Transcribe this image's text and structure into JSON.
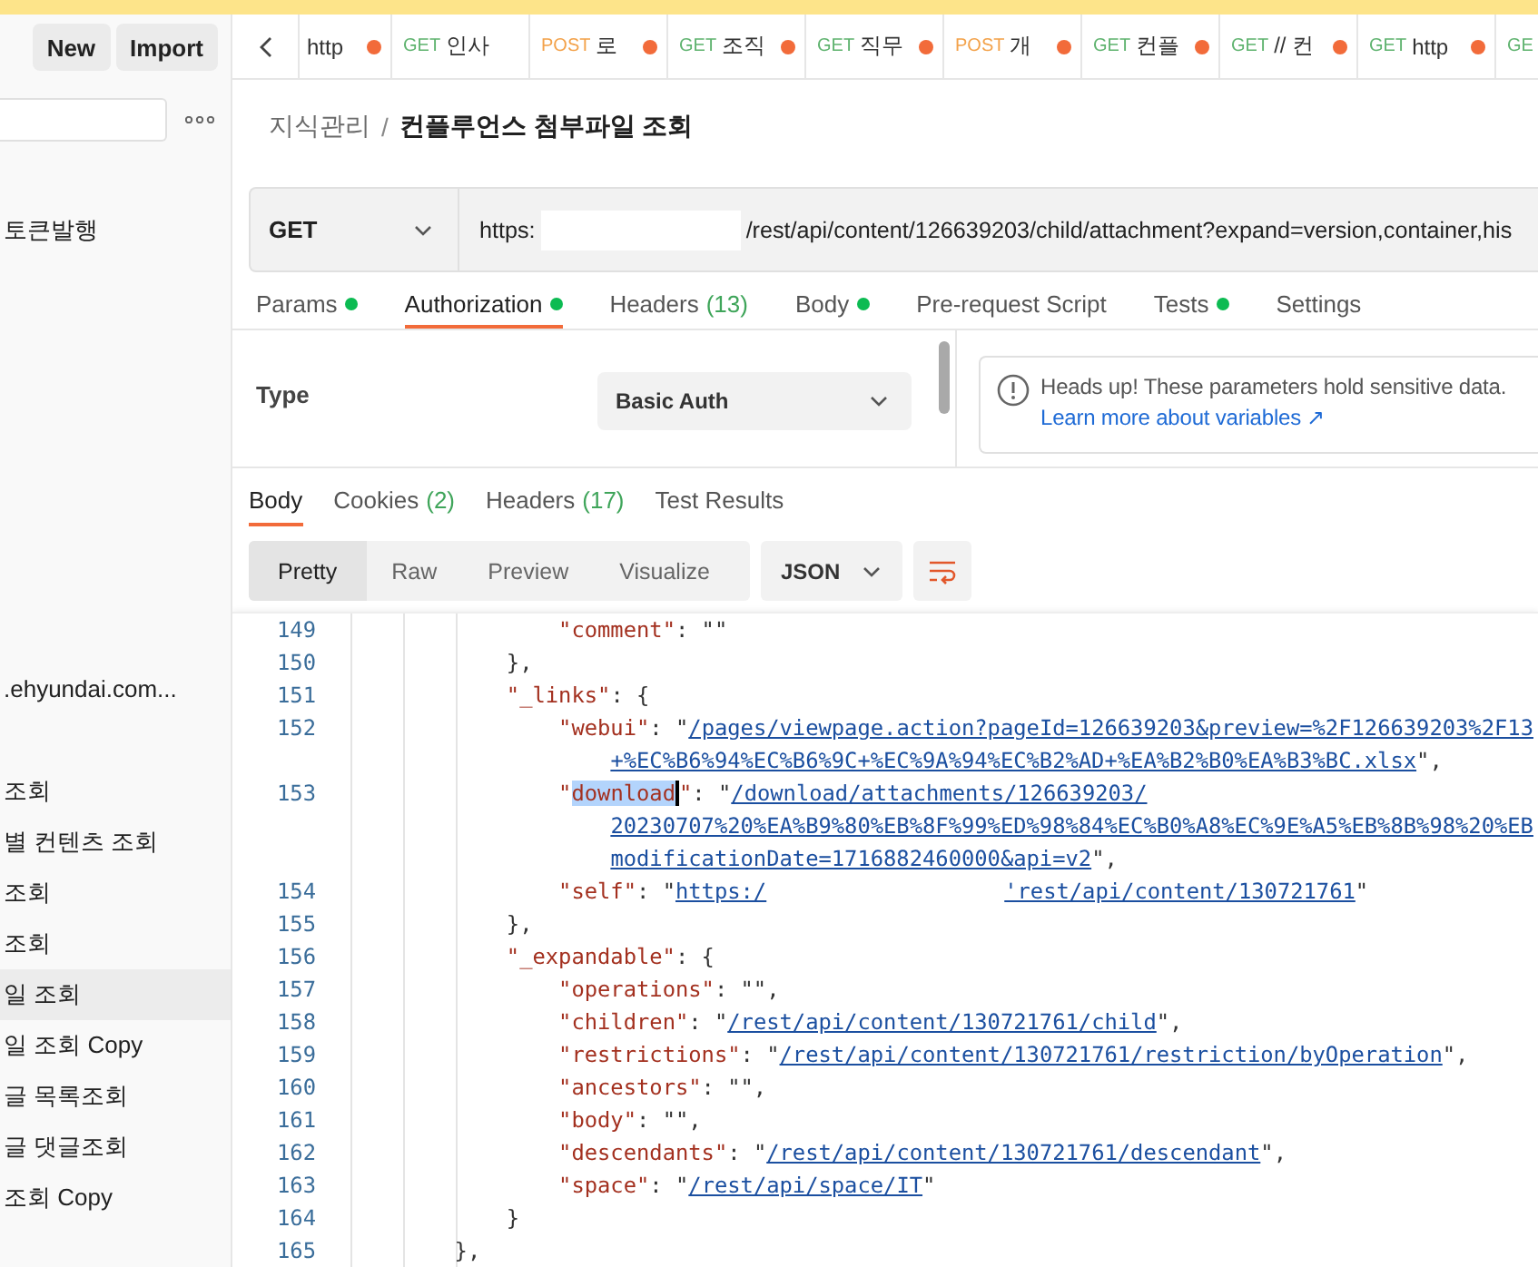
{
  "top_bar": {
    "buttons": [
      "New",
      "Import"
    ]
  },
  "sidebar": {
    "items": [
      {
        "label": "토큰발행",
        "selected": false
      },
      {
        "label": ".ehyundai.com...",
        "selected": false
      },
      {
        "label": "조회",
        "selected": false
      },
      {
        "label": "별 컨텐츠 조회",
        "selected": false
      },
      {
        "label": "조회",
        "selected": false
      },
      {
        "label": "조회",
        "selected": false
      },
      {
        "label": "일 조회",
        "selected": true
      },
      {
        "label": "일 조회 Copy",
        "selected": false
      },
      {
        "label": "글 목록조회",
        "selected": false
      },
      {
        "label": "글 댓글조회",
        "selected": false
      },
      {
        "label": "조회 Copy",
        "selected": false
      }
    ]
  },
  "open_tabs": [
    {
      "kind": "none",
      "name": "http",
      "unsaved": true
    },
    {
      "kind": "get",
      "method": "GET",
      "name": "인사",
      "unsaved": false
    },
    {
      "kind": "post",
      "method": "POST",
      "name": "로",
      "unsaved": true
    },
    {
      "kind": "get",
      "method": "GET",
      "name": "조직",
      "unsaved": true
    },
    {
      "kind": "get",
      "method": "GET",
      "name": "직무",
      "unsaved": true
    },
    {
      "kind": "post",
      "method": "POST",
      "name": "개",
      "unsaved": true
    },
    {
      "kind": "get",
      "method": "GET",
      "name": "컨플",
      "unsaved": true
    },
    {
      "kind": "get",
      "method": "GET",
      "name": "// 컨",
      "unsaved": true
    },
    {
      "kind": "get",
      "method": "GET",
      "name": "http",
      "unsaved": true
    },
    {
      "kind": "get",
      "method": "GE",
      "unsaved": false
    }
  ],
  "breadcrumb": {
    "parent": "지식관리",
    "separator": "/",
    "current": "컨플루언스 첨부파일 조회"
  },
  "request": {
    "method": "GET",
    "url_start": "https:",
    "url_end": "/rest/api/content/126639203/child/attachment?expand=version,container,his"
  },
  "request_sections": [
    {
      "label": "Params",
      "dot": true,
      "selected": false
    },
    {
      "label": "Authorization",
      "dot": true,
      "selected": true
    },
    {
      "label": "Headers",
      "count": "(13)",
      "dot": false,
      "selected": false
    },
    {
      "label": "Body",
      "dot": true,
      "selected": false
    },
    {
      "label": "Pre-request Script",
      "dot": false,
      "selected": false
    },
    {
      "label": "Tests",
      "dot": true,
      "selected": false
    },
    {
      "label": "Settings",
      "dot": false,
      "selected": false
    }
  ],
  "auth": {
    "type_label": "Type",
    "type_value": "Basic Auth",
    "notice": "Heads up! These parameters hold sensitive data.",
    "link": "Learn more about variables ↗"
  },
  "response": {
    "tabs": [
      {
        "label": "Body",
        "selected": true
      },
      {
        "label": "Cookies",
        "count": "(2)",
        "selected": false
      },
      {
        "label": "Headers",
        "count": "(17)",
        "selected": false
      },
      {
        "label": "Test Results",
        "selected": false
      }
    ],
    "views": [
      {
        "label": "Pretty",
        "selected": true
      },
      {
        "label": "Raw",
        "selected": false
      },
      {
        "label": "Preview",
        "selected": false
      },
      {
        "label": "Visualize",
        "selected": false
      }
    ],
    "format": "JSON",
    "lines": [
      {
        "number": "149",
        "rows": [
          {
            "segments": [
              {
                "kind": "key",
                "text": "                \"comment\""
              },
              {
                "kind": "punct",
                "text": ": \"\""
              }
            ]
          }
        ]
      },
      {
        "number": "150",
        "rows": [
          {
            "segments": [
              {
                "kind": "punct",
                "text": "            },"
              }
            ]
          }
        ]
      },
      {
        "number": "151",
        "rows": [
          {
            "segments": [
              {
                "kind": "key",
                "text": "            \"_links\""
              },
              {
                "kind": "punct",
                "text": ": {"
              }
            ]
          }
        ]
      },
      {
        "number": "152",
        "rows": [
          {
            "segments": [
              {
                "kind": "key",
                "text": "                \"webui\""
              },
              {
                "kind": "punct",
                "text": ": \""
              },
              {
                "kind": "link",
                "text": "/pages/viewpage.action?pageId=126639203&preview=%2F126639203%2F13"
              }
            ]
          },
          {
            "segments": [
              {
                "kind": "link",
                "text": "                    +%EC%B6%94%EC%B6%9C+%EC%9A%94%EC%B2%AD+%EA%B2%B0%EA%B3%BC.xlsx"
              },
              {
                "kind": "punct",
                "text": "\","
              }
            ]
          }
        ]
      },
      {
        "number": "153",
        "rows": [
          {
            "segments": [
              {
                "kind": "key",
                "text": "                \""
              },
              {
                "kind": "key",
                "text": "download",
                "highlighted": true
              },
              {
                "kind": "key",
                "text": "\""
              },
              {
                "kind": "punct",
                "text": ": \""
              },
              {
                "kind": "link",
                "text": "/download/attachments/126639203/"
              }
            ]
          },
          {
            "segments": [
              {
                "kind": "link",
                "text": "                    20230707%20%EA%B9%80%EB%8F%99%ED%98%84%EC%B0%A8%EC%9E%A5%EB%8B%98%20%EB"
              }
            ]
          },
          {
            "segments": [
              {
                "kind": "link",
                "text": "                    modificationDate=1716882460000&api=v2"
              },
              {
                "kind": "punct",
                "text": "\","
              }
            ]
          }
        ]
      },
      {
        "number": "154",
        "rows": [
          {
            "segments": [
              {
                "kind": "key",
                "text": "                \"self\""
              },
              {
                "kind": "punct",
                "text": ": \""
              },
              {
                "kind": "link",
                "text": "https:/"
              },
              {
                "kind": "redacted"
              },
              {
                "kind": "link",
                "text": "'rest/api/content/130721761"
              },
              {
                "kind": "punct",
                "text": "\""
              }
            ]
          }
        ]
      },
      {
        "number": "155",
        "rows": [
          {
            "segments": [
              {
                "kind": "punct",
                "text": "            },"
              }
            ]
          }
        ]
      },
      {
        "number": "156",
        "rows": [
          {
            "segments": [
              {
                "kind": "key",
                "text": "            \"_expandable\""
              },
              {
                "kind": "punct",
                "text": ": {"
              }
            ]
          }
        ]
      },
      {
        "number": "157",
        "rows": [
          {
            "segments": [
              {
                "kind": "key",
                "text": "                \"operations\""
              },
              {
                "kind": "punct",
                "text": ": \"\","
              }
            ]
          }
        ]
      },
      {
        "number": "158",
        "rows": [
          {
            "segments": [
              {
                "kind": "key",
                "text": "                \"children\""
              },
              {
                "kind": "punct",
                "text": ": \""
              },
              {
                "kind": "link",
                "text": "/rest/api/content/130721761/child"
              },
              {
                "kind": "punct",
                "text": "\","
              }
            ]
          }
        ]
      },
      {
        "number": "159",
        "rows": [
          {
            "segments": [
              {
                "kind": "key",
                "text": "                \"restrictions\""
              },
              {
                "kind": "punct",
                "text": ": \""
              },
              {
                "kind": "link",
                "text": "/rest/api/content/130721761/restriction/byOperation"
              },
              {
                "kind": "punct",
                "text": "\","
              }
            ]
          }
        ]
      },
      {
        "number": "160",
        "rows": [
          {
            "segments": [
              {
                "kind": "key",
                "text": "                \"ancestors\""
              },
              {
                "kind": "punct",
                "text": ": \"\","
              }
            ]
          }
        ]
      },
      {
        "number": "161",
        "rows": [
          {
            "segments": [
              {
                "kind": "key",
                "text": "                \"body\""
              },
              {
                "kind": "punct",
                "text": ": \"\","
              }
            ]
          }
        ]
      },
      {
        "number": "162",
        "rows": [
          {
            "segments": [
              {
                "kind": "key",
                "text": "                \"descendants\""
              },
              {
                "kind": "punct",
                "text": ": \""
              },
              {
                "kind": "link",
                "text": "/rest/api/content/130721761/descendant"
              },
              {
                "kind": "punct",
                "text": "\","
              }
            ]
          }
        ]
      },
      {
        "number": "163",
        "rows": [
          {
            "segments": [
              {
                "kind": "key",
                "text": "                \"space\""
              },
              {
                "kind": "punct",
                "text": ": \""
              },
              {
                "kind": "link",
                "text": "/rest/api/space/IT"
              },
              {
                "kind": "punct",
                "text": "\""
              }
            ]
          }
        ]
      },
      {
        "number": "164",
        "rows": [
          {
            "segments": [
              {
                "kind": "punct",
                "text": "            }"
              }
            ]
          }
        ]
      },
      {
        "number": "165",
        "rows": [
          {
            "segments": [
              {
                "kind": "punct",
                "text": "        },"
              }
            ]
          }
        ]
      }
    ]
  }
}
